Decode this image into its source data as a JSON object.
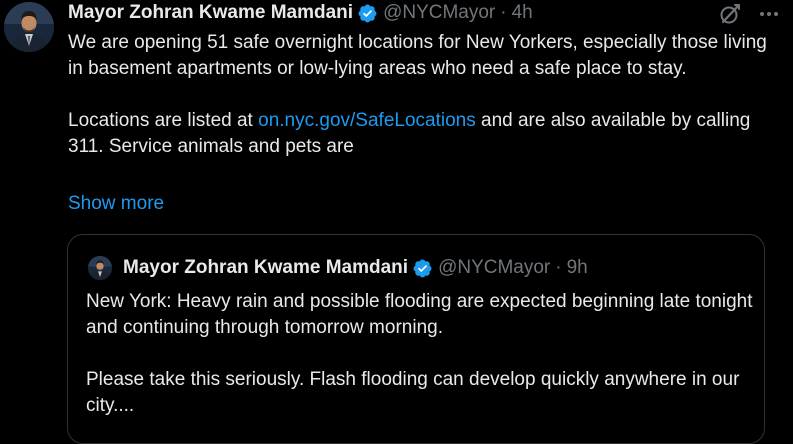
{
  "post": {
    "author_name": "Mayor Zohran Kwame Mamdani",
    "handle": "@NYCMayor",
    "separator": "·",
    "time": "4h",
    "body_line1": "We are opening 51 safe overnight locations for New Yorkers, especially those living in basement apartments or low-lying areas who need a safe place to stay.",
    "body_line2_prefix": "Locations are listed at ",
    "body_link": "on.nyc.gov/SafeLocations",
    "body_line2_suffix": " and are also available by calling 311. Service animals and pets are",
    "show_more": "Show more"
  },
  "quoted_post": {
    "author_name": "Mayor Zohran Kwame Mamdani",
    "handle": "@NYCMayor",
    "separator": "·",
    "time": "9h",
    "body_para1": "New York: Heavy rain and possible flooding are expected beginning late tonight and continuing through tomorrow morning.",
    "body_para2": "Please take this seriously. Flash flooding can develop quickly anywhere in our city...."
  },
  "icons": {
    "verified": "verified-badge-icon",
    "grok": "grok-icon",
    "more": "more-options-icon"
  },
  "colors": {
    "background": "#000000",
    "text": "#e7e9ea",
    "secondary_text": "#71767b",
    "link": "#1d9bf0",
    "verified": "#1d9bf0",
    "border": "#2f3336"
  }
}
